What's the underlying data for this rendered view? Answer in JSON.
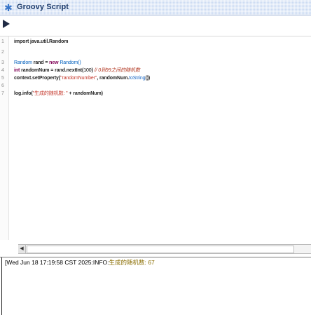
{
  "window": {
    "title": "Groovy Script",
    "icon": "gear-icon"
  },
  "toolbar": {
    "run_icon": "play-icon"
  },
  "editor": {
    "lines": [
      {
        "n": "1",
        "tokens": [
          {
            "t": "import java.util.Random",
            "c": "plain"
          }
        ]
      },
      {
        "n": "2",
        "tokens": []
      },
      {
        "n": "3",
        "tokens": [
          {
            "t": "Random",
            "c": "cls"
          },
          {
            "t": " rand = ",
            "c": "bold"
          },
          {
            "t": "new",
            "c": "kw"
          },
          {
            "t": " ",
            "c": "plain"
          },
          {
            "t": "Random()",
            "c": "cls"
          }
        ]
      },
      {
        "n": "4",
        "tokens": [
          {
            "t": "int",
            "c": "kw"
          },
          {
            "t": " randomNum = rand.nextInt(",
            "c": "bold"
          },
          {
            "t": "100",
            "c": "plain"
          },
          {
            "t": ") ",
            "c": "bold"
          },
          {
            "t": "// 0到99之间的随机数",
            "c": "cmt"
          }
        ]
      },
      {
        "n": "5",
        "tokens": [
          {
            "t": "context.setProperty(",
            "c": "bold"
          },
          {
            "t": "\"randomNumber\"",
            "c": "str"
          },
          {
            "t": ", randomNum.",
            "c": "bold"
          },
          {
            "t": "toString",
            "c": "meth"
          },
          {
            "t": "())",
            "c": "bold"
          }
        ]
      },
      {
        "n": "6",
        "tokens": []
      },
      {
        "n": "7",
        "tokens": [
          {
            "t": "log.info(",
            "c": "bold"
          },
          {
            "t": "\"生成的随机数: \"",
            "c": "str"
          },
          {
            "t": " + randomNum)",
            "c": "bold"
          }
        ]
      }
    ]
  },
  "scrollbar": {
    "left_arrow": "◀"
  },
  "console": {
    "prefix": "[Wed Jun 18 17:19:58 CST 2025:INFO:",
    "message": "生成的随机数: 67"
  }
}
